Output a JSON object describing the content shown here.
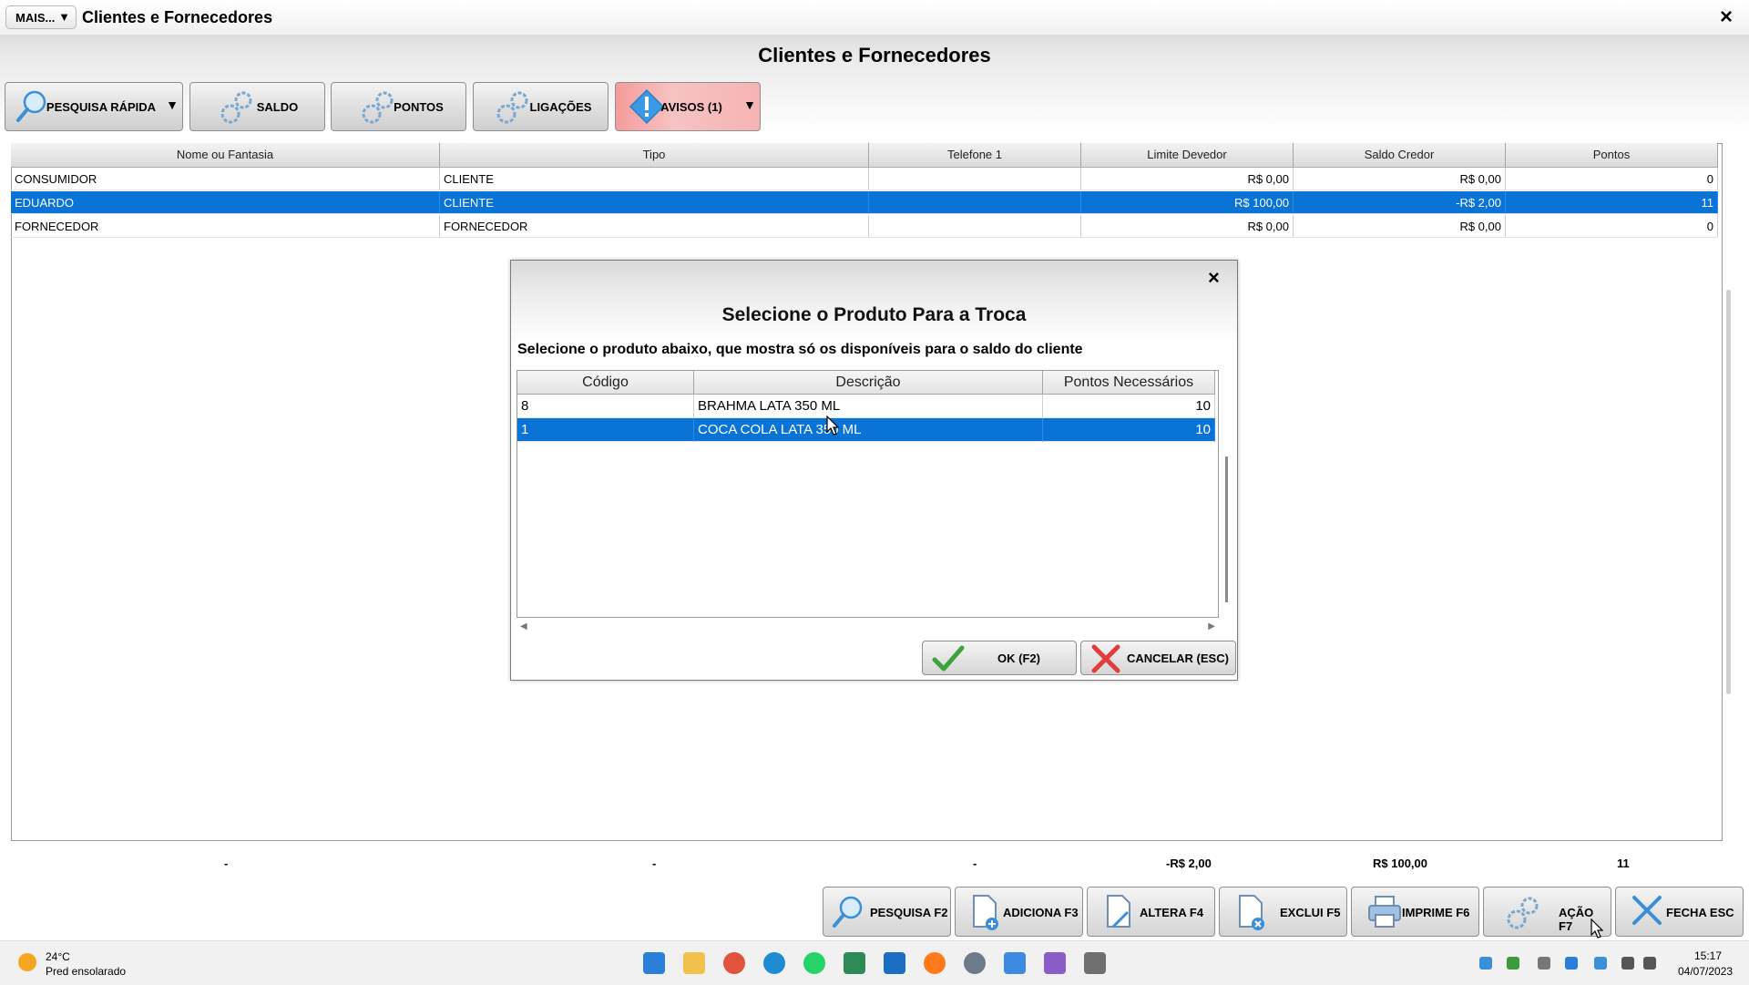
{
  "window": {
    "menu_label": "MAIS...",
    "title": "Clientes e Fornecedores",
    "close": "×"
  },
  "main_title": "Clientes e Fornecedores",
  "toolbar": {
    "quick_search": "PESQUISA RÁPIDA",
    "saldo": "SALDO",
    "pontos": "PONTOS",
    "ligacoes": "LIGAÇÕES",
    "avisos": "AVISOS (1)"
  },
  "grid": {
    "columns": [
      "Nome ou Fantasia",
      "Tipo",
      "Telefone 1",
      "Limite Devedor",
      "Saldo Credor",
      "Pontos"
    ],
    "rows": [
      {
        "nome": "CONSUMIDOR",
        "tipo": "CLIENTE",
        "telefone": "",
        "limite": "R$ 0,00",
        "saldo": "R$ 0,00",
        "pontos": "0"
      },
      {
        "nome": "EDUARDO",
        "tipo": "CLIENTE",
        "telefone": "",
        "limite": "R$ 100,00",
        "saldo": "-R$ 2,00",
        "pontos": "11"
      },
      {
        "nome": "FORNECEDOR",
        "tipo": "FORNECEDOR",
        "telefone": "",
        "limite": "R$ 0,00",
        "saldo": "R$ 0,00",
        "pontos": "0"
      }
    ]
  },
  "totals": {
    "nome": "-",
    "tipo": "-",
    "telefone": "-",
    "limite": "-R$ 2,00",
    "saldo": "R$ 100,00",
    "pontos": "11"
  },
  "modal": {
    "close": "×",
    "title": "Selecione o Produto Para a Troca",
    "subtitle": "Selecione o produto abaixo, que mostra só os disponíveis para o saldo do cliente",
    "columns": [
      "Código",
      "Descrição",
      "Pontos Necessários"
    ],
    "rows": [
      {
        "codigo": "8",
        "descricao": "BRAHMA LATA 350 ML",
        "pontos": "10"
      },
      {
        "codigo": "1",
        "descricao": "COCA COLA LATA 350 ML",
        "pontos": "10"
      }
    ],
    "ok": "OK (F2)",
    "cancel": "CANCELAR (ESC)"
  },
  "bottom_buttons": {
    "pesquisa": "PESQUISA F2",
    "adiciona": "ADICIONA F3",
    "altera": "ALTERA F4",
    "exclui": "EXCLUI F5",
    "imprime": "IMPRIME F6",
    "acao": "AÇÃO F7",
    "fecha": "FECHA ESC"
  },
  "taskbar": {
    "temperature": "24°C",
    "weather": "Pred ensolarado",
    "time": "15:17",
    "date": "04/07/2023"
  },
  "colors": {
    "selection": "#0a73d6",
    "avisos": "#f59b9b"
  }
}
